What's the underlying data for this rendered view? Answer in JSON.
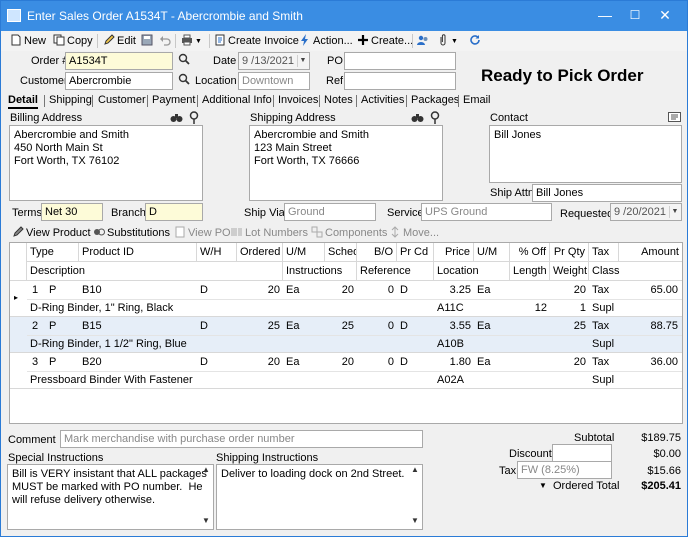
{
  "window": {
    "title": "Enter Sales Order A1534T - Abercrombie and Smith",
    "min": "—",
    "max": "☐",
    "close": "✕"
  },
  "toolbar": {
    "new": "New",
    "copy": "Copy",
    "edit": "Edit",
    "create_invoice": "Create Invoice",
    "action": "Action...",
    "create": "Create..."
  },
  "header": {
    "order_label": "Order #",
    "order_value": "A1534T",
    "date_label": "Date",
    "date_value": "9 /13/2021",
    "po_label": "PO",
    "po_value": "",
    "customer_label": "Customer",
    "customer_value": "Abercrombie",
    "location_label": "Location",
    "location_placeholder": "Downtown",
    "ref_label": "Ref",
    "ref_value": "",
    "status": "Ready to Pick Order"
  },
  "tabs": [
    "Detail",
    "Shipping",
    "Customer",
    "Payment",
    "Additional Info",
    "Invoices",
    "Notes",
    "Activities",
    "Packages",
    "Email"
  ],
  "billing": {
    "label": "Billing Address",
    "text": "Abercrombie and Smith\n450 North Main St\nFort Worth, TX 76102"
  },
  "shipping": {
    "label": "Shipping Address",
    "text": "Abercrombie and Smith\n123 Main Street\nFort Worth, TX 76666"
  },
  "contact": {
    "label": "Contact",
    "text": "Bill Jones",
    "ship_attn_label": "Ship Attn",
    "ship_attn_value": "Bill Jones"
  },
  "terms": {
    "terms_label": "Terms",
    "terms_value": "Net 30",
    "branch_label": "Branch",
    "branch_value": "D",
    "shipvia_label": "Ship Via",
    "shipvia_value": "Ground",
    "service_label": "Service",
    "service_value": "UPS Ground",
    "requested_label": "Requested",
    "requested_value": "9 /20/2021"
  },
  "line_actions": {
    "view_product": "View Product",
    "substitutions": "Substitutions",
    "view_po": "View PO",
    "lot_numbers": "Lot Numbers",
    "components": "Components",
    "move": "Move..."
  },
  "grid": {
    "headers1": [
      "",
      "Type",
      "Product ID",
      "W/H",
      "Ordered",
      "U/M",
      "Sched",
      "B/O",
      "Pr Cd",
      "Price",
      "U/M",
      "% Off",
      "Pr Qty",
      "Tax",
      "Amount"
    ],
    "headers2": [
      "Description",
      "Instructions",
      "Reference",
      "Location",
      "Length",
      "Weight",
      "Class"
    ],
    "rows": [
      {
        "num": "1",
        "type": "P",
        "pid": "B10",
        "wh": "D",
        "ordered": "20",
        "um": "Ea",
        "sched": "20",
        "bo": "0",
        "prcd": "D",
        "price": "3.25",
        "um2": "Ea",
        "proff": "",
        "prqty": "20",
        "tax": "Tax",
        "amount": "65.00",
        "desc": "D-Ring Binder, 1\" Ring, Black",
        "location": "A11C",
        "length": "12",
        "weight": "1",
        "class": "Supl"
      },
      {
        "num": "2",
        "type": "P",
        "pid": "B15",
        "wh": "D",
        "ordered": "25",
        "um": "Ea",
        "sched": "25",
        "bo": "0",
        "prcd": "D",
        "price": "3.55",
        "um2": "Ea",
        "proff": "",
        "prqty": "25",
        "tax": "Tax",
        "amount": "88.75",
        "desc": "D-Ring Binder, 1 1/2\" Ring, Blue",
        "location": "A10B",
        "length": "",
        "weight": "",
        "class": "Supl"
      },
      {
        "num": "3",
        "type": "P",
        "pid": "B20",
        "wh": "D",
        "ordered": "20",
        "um": "Ea",
        "sched": "20",
        "bo": "0",
        "prcd": "D",
        "price": "1.80",
        "um2": "Ea",
        "proff": "",
        "prqty": "20",
        "tax": "Tax",
        "amount": "36.00",
        "desc": "Pressboard Binder With Fastener",
        "location": "A02A",
        "length": "",
        "weight": "",
        "class": "Supl"
      }
    ]
  },
  "footer": {
    "comment_label": "Comment",
    "comment_placeholder": "Mark merchandise with purchase order number",
    "special_label": "Special Instructions",
    "special_text": "Bill is VERY insistant that ALL packages\nMUST be marked with PO number.  He\nwill refuse delivery otherwise.",
    "shipinst_label": "Shipping Instructions",
    "shipinst_text": "Deliver to loading dock on 2nd Street.",
    "subtotal_label": "Subtotal",
    "subtotal_value": "$189.75",
    "discount_label": "Discount",
    "discount_value": "$0.00",
    "tax_label": "Tax",
    "tax_code": "FW (8.25%)",
    "tax_value": "$15.66",
    "ordered_total_label": "Ordered Total",
    "ordered_total_value": "$205.41"
  }
}
